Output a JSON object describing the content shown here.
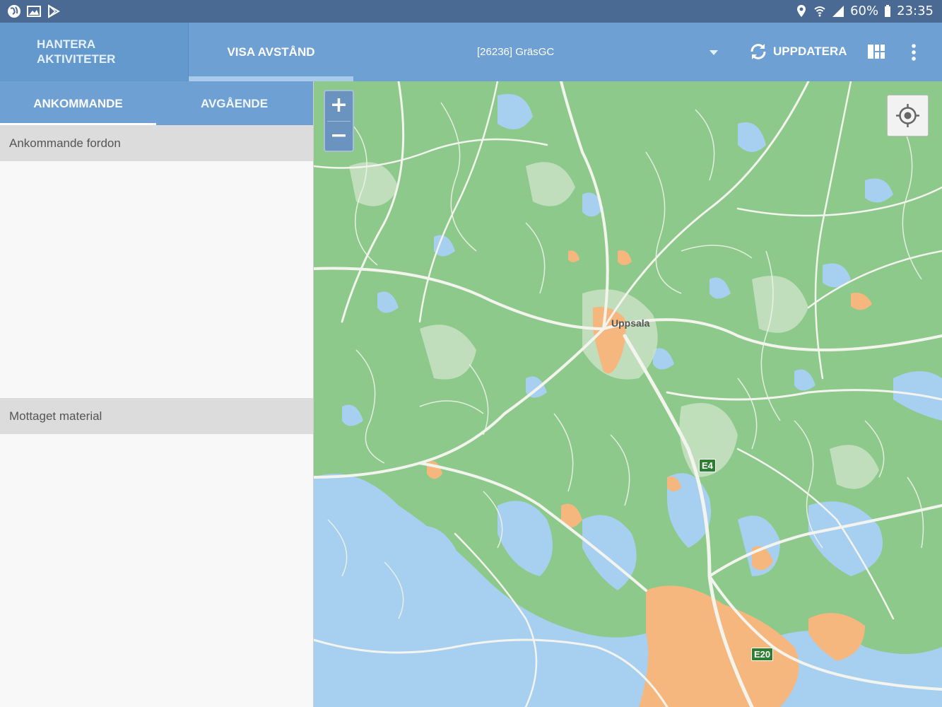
{
  "status_bar": {
    "battery": "60%",
    "time": "23:35"
  },
  "app_bar": {
    "tab_manage": "HANTERA AKTIVITETER",
    "tab_distance": "VISA AVSTÅND",
    "site_select": "[26236] GräsGC",
    "update_label": "UPPDATERA"
  },
  "left_panel": {
    "tabs": [
      "ANKOMMANDE",
      "AVGÅENDE"
    ],
    "active_tab": "ANKOMMANDE",
    "section_arrivals": "Ankommande fordon",
    "section_material": "Mottaget material"
  },
  "map": {
    "zoom_in": "+",
    "zoom_out": "−",
    "labels": {
      "city": "Uppsala",
      "e4": "E4",
      "e20": "E20"
    },
    "colors": {
      "land": "#8cc98a",
      "water": "#a7d0f0",
      "urban": "#f5b77d",
      "road": "#f4f4ee"
    }
  },
  "colors": {
    "status_bar": "#4a6a94",
    "app_bar": "#6ea0d4",
    "section_header": "#dcdcdd"
  }
}
